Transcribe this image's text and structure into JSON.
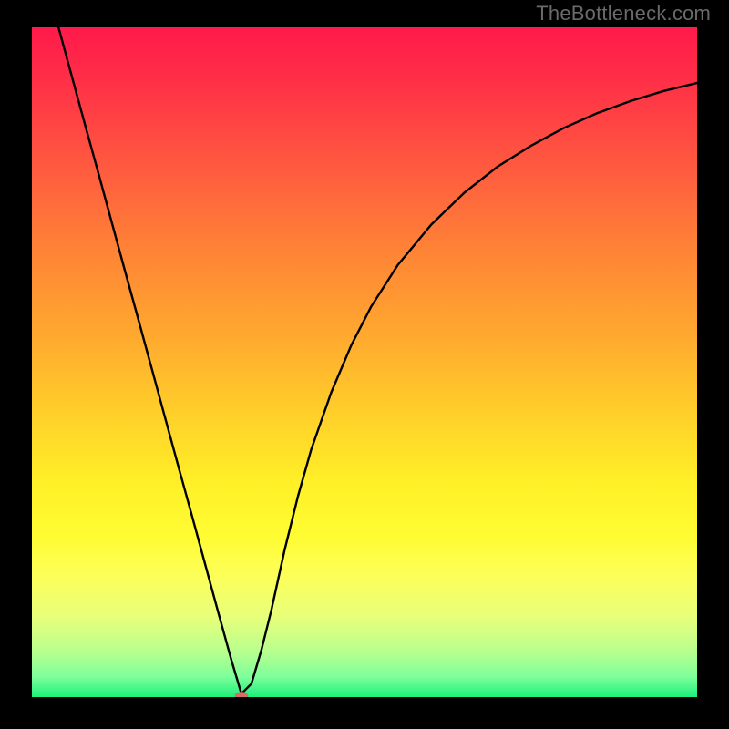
{
  "attribution": "TheBottleneck.com",
  "colors": {
    "background": "#000000",
    "gradient_top": "#ff1a4b",
    "gradient_bottom": "#1bf07b",
    "curve": "#000000",
    "marker": "#dd6a6a",
    "attribution_text": "#6a6a6a"
  },
  "chart_data": {
    "type": "line",
    "title": "",
    "xlabel": "",
    "ylabel": "",
    "xlim": [
      0,
      100
    ],
    "ylim": [
      0,
      100
    ],
    "grid": false,
    "series": [
      {
        "name": "bottleneck-curve",
        "x": [
          4,
          6,
          8,
          10,
          12,
          14,
          16,
          18,
          20,
          22,
          24,
          26,
          28,
          30,
          31.5,
          33,
          34.5,
          36,
          38,
          40,
          42,
          45,
          48,
          51,
          55,
          60,
          65,
          70,
          75,
          80,
          85,
          90,
          95,
          100
        ],
        "y": [
          100,
          92.7,
          85.4,
          78.2,
          70.9,
          63.6,
          56.4,
          49.1,
          41.8,
          34.5,
          27.3,
          20.0,
          12.7,
          5.5,
          0.5,
          2.0,
          7.0,
          13.0,
          22.0,
          30.0,
          37.0,
          45.5,
          52.5,
          58.3,
          64.5,
          70.5,
          75.3,
          79.2,
          82.3,
          85.0,
          87.2,
          89.0,
          90.5,
          91.7
        ]
      }
    ],
    "marker": {
      "x": 31.5,
      "y": 0.2,
      "rx": 1.0,
      "ry": 0.6
    }
  }
}
